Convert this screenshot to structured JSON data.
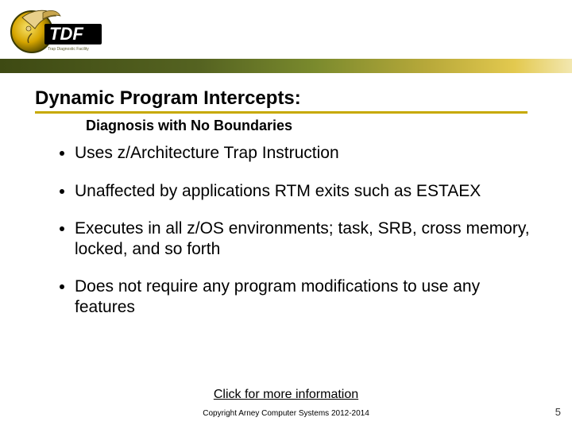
{
  "logo": {
    "text": "TDF"
  },
  "title": "Dynamic Program Intercepts:",
  "subtitle": "Diagnosis with No Boundaries",
  "bullets": [
    "Uses z/Architecture Trap Instruction",
    "Unaffected by applications RTM exits such as ESTAEX",
    "Executes in all z/OS environments; task, SRB, cross memory, locked, and so forth",
    "Does not require any program modifications to use any features"
  ],
  "more_link": "Click for more information",
  "copyright": "Copyright Arney Computer Systems 2012-2014",
  "slide_number": "5"
}
